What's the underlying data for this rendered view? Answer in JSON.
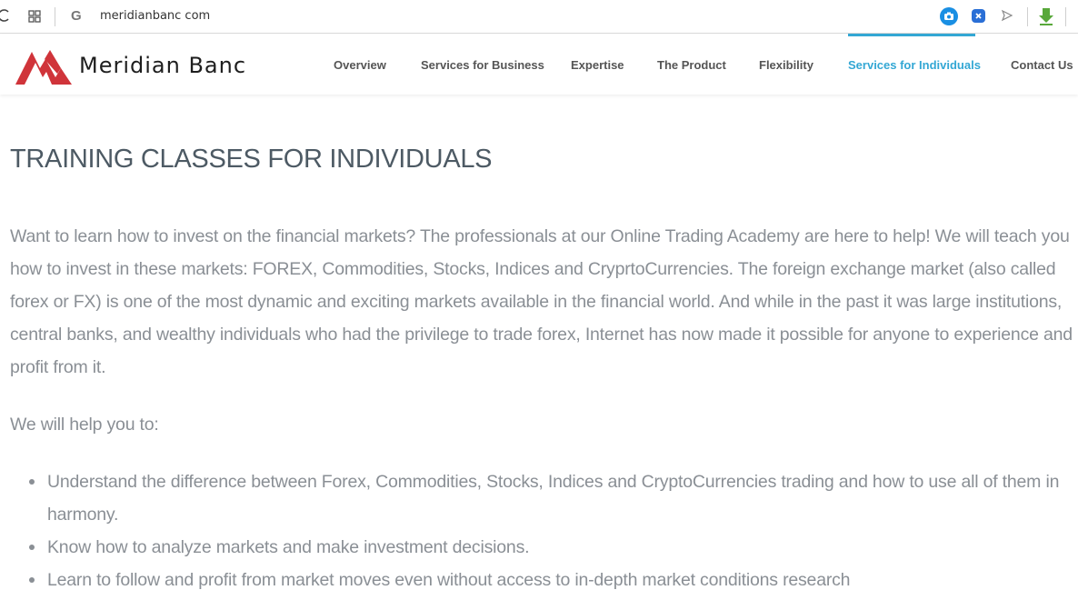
{
  "browser": {
    "url": "meridianbanc com",
    "google_glyph": "G",
    "icons": [
      "reload-icon",
      "tabs-grid-icon",
      "google-icon",
      "camera-icon",
      "extension-icon",
      "send-icon",
      "download-icon"
    ]
  },
  "brand": {
    "name": "Meridian Banc",
    "colors": {
      "logo_red": "#d0343a",
      "accent": "#33a7d4",
      "text_muted": "#8a8f95",
      "title": "#4d5a64"
    }
  },
  "nav": {
    "items": [
      {
        "label": "Overview"
      },
      {
        "label": "Services for Business"
      },
      {
        "label": "Expertise"
      },
      {
        "label": "The Product"
      },
      {
        "label": "Flexibility"
      },
      {
        "label": "Services for Individuals",
        "active": true
      },
      {
        "label": "Contact Us"
      }
    ]
  },
  "content": {
    "title": "TRAINING CLASSES FOR INDIVIDUALS",
    "intro": "Want to learn how to invest on the financial markets? The professionals at our Online Trading Academy are here to help! We will teach you how to invest in these markets: FOREX, Commodities, Stocks, Indices and CryprtoCurrencies. The foreign exchange market (also called forex or FX) is one of the most dynamic and exciting markets available in the financial world. And while in the past it was large institutions, central banks, and wealthy individuals who had the privilege to trade forex, Internet has now made it possible for anyone to experience and profit from it.",
    "help_lead": "We will help you to:",
    "bullets": [
      "Understand the difference between Forex, Commodities, Stocks, Indices and CryptoCurrencies trading and how to use all of them in harmony.",
      "Know how to analyze markets and make investment decisions.",
      "Learn to follow and profit from market moves even without access to in-depth market conditions research"
    ]
  }
}
